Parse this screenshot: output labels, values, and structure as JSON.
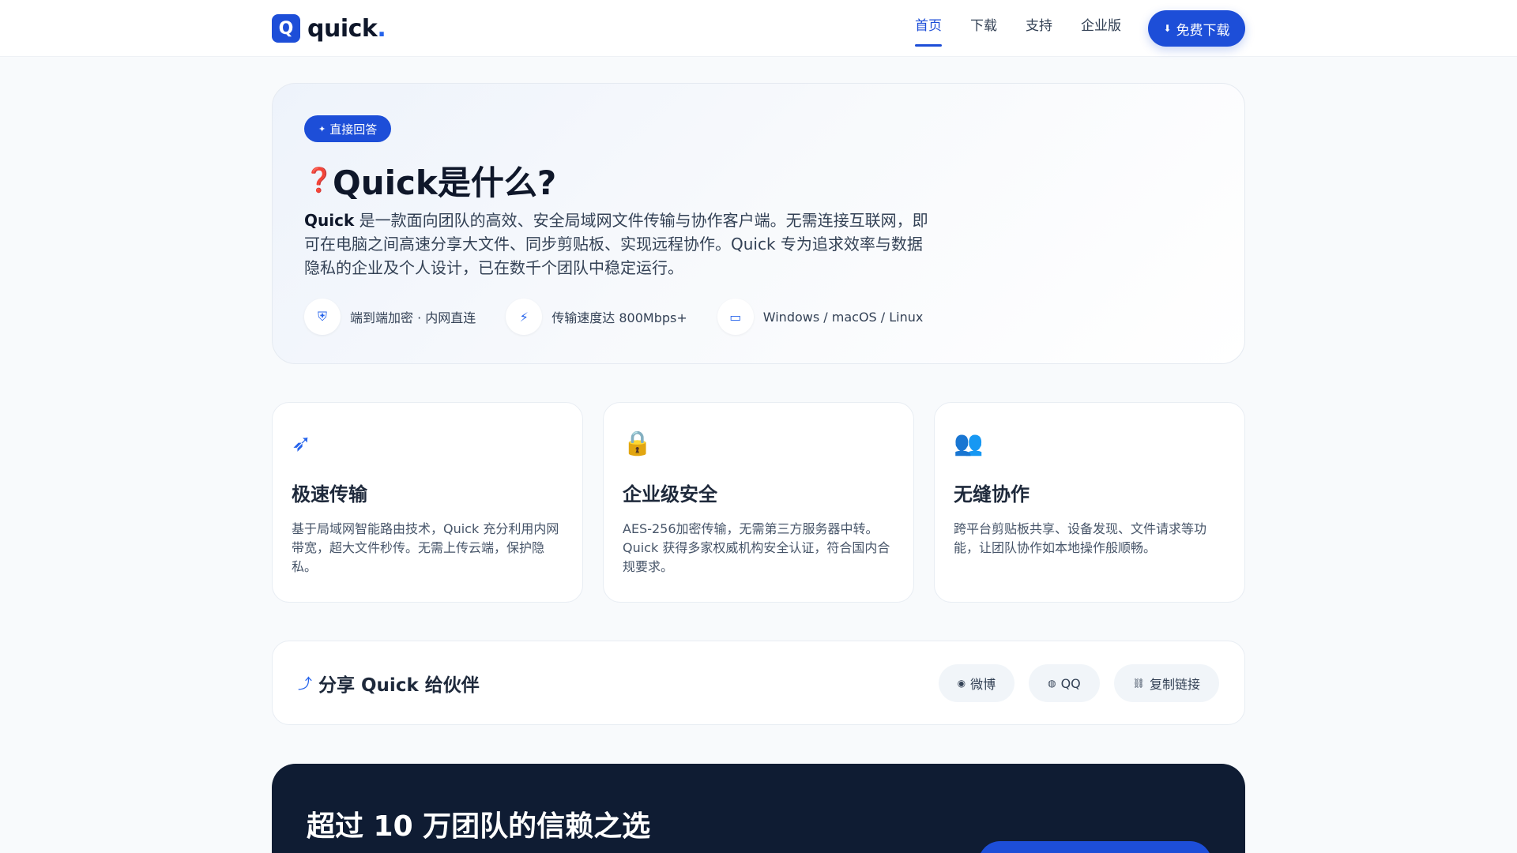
{
  "brand": {
    "logo_letter": "Q",
    "name": "quick",
    "dot": "."
  },
  "nav": {
    "items": [
      {
        "label": "首页",
        "active": true
      },
      {
        "label": "下载",
        "active": false
      },
      {
        "label": "支持",
        "active": false
      },
      {
        "label": "企业版",
        "active": false
      }
    ],
    "download_icon": "download-icon",
    "download_label": "免费下载"
  },
  "hero": {
    "badge_icon": "lightbulb-icon",
    "badge_label": "直接回答",
    "title_icon": "question-icon",
    "title": "Quick是什么?",
    "desc_strong": "Quick",
    "desc_rest": " 是一款面向团队的高效、安全局域网文件传输与协作客户端。无需连接互联网，即可在电脑之间高速分享大文件、同步剪贴板、实现远程协作。Quick 专为追求效率与数据隐私的企业及个人设计，已在数千个团队中稳定运行。",
    "tags": [
      {
        "icon": "shield-icon",
        "label": "端到端加密 · 内网直连"
      },
      {
        "icon": "bolt-icon",
        "label": "传输速度达 800Mbps+"
      },
      {
        "icon": "desktop-icon",
        "label": "Windows / macOS / Linux"
      }
    ]
  },
  "features": [
    {
      "icon": "rocket-icon",
      "title": "极速传输",
      "desc": "基于局域网智能路由技术，Quick 充分利用内网带宽，超大文件秒传。无需上传云端，保护隐私。"
    },
    {
      "icon": "lock-icon",
      "title": "企业级安全",
      "desc": "AES-256加密传输，无需第三方服务器中转。Quick 获得多家权威机构安全认证，符合国内合规要求。"
    },
    {
      "icon": "users-icon",
      "title": "无缝协作",
      "desc": "跨平台剪贴板共享、设备发现、文件请求等功能，让团队协作如本地操作般顺畅。"
    }
  ],
  "share": {
    "icon": "share-icon",
    "title": "分享 Quick 给伙伴",
    "buttons": [
      {
        "icon": "weibo-icon",
        "label": "微博"
      },
      {
        "icon": "qq-icon",
        "label": "QQ"
      },
      {
        "icon": "link-icon",
        "label": "复制链接"
      }
    ]
  },
  "trust": {
    "title": "超过 10 万团队的信赖之选"
  },
  "colors": {
    "accent": "#1d4ed8",
    "dark_panel": "#0f1c33",
    "page_bg": "#f8fafc"
  }
}
